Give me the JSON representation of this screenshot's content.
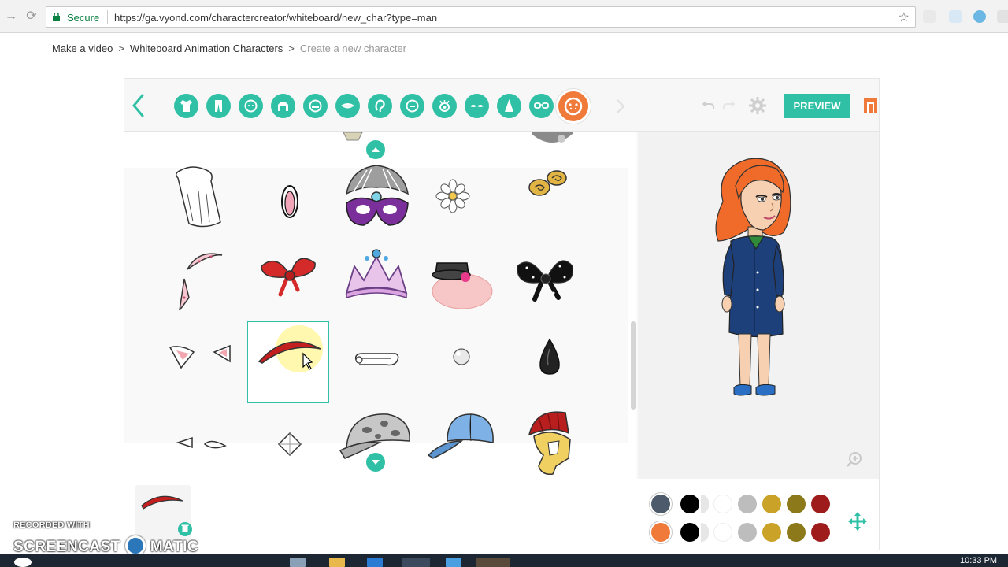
{
  "browser": {
    "secure_label": "Secure",
    "url": "https://ga.vyond.com/charactercreator/whiteboard/new_char?type=man",
    "icons": [
      "back-icon",
      "forward-icon",
      "reload-icon",
      "lock-icon",
      "star-icon"
    ]
  },
  "breadcrumb": {
    "items": [
      "Make a video",
      "Whiteboard Animation Characters",
      "Create a new character"
    ],
    "separator": ">"
  },
  "toolbar": {
    "categories": [
      "upper-body",
      "lower-body",
      "head",
      "hair",
      "face",
      "mouth",
      "ear",
      "nose",
      "eye",
      "eyebrow",
      "body-shape",
      "glasses",
      "accessories"
    ],
    "active_category": "accessories",
    "preview_label": "PREVIEW",
    "accent_color": "#2fc0a5",
    "active_color": "#f07a3a"
  },
  "items": {
    "rows": [
      [
        "chef-hat",
        "hair-clip",
        "feather-mask",
        "flower-pin",
        "gold-barrettes"
      ],
      [
        "cat-ear-band",
        "red-bow",
        "tiara",
        "mini-top-hat",
        "black-bow"
      ],
      [
        "cat-ears",
        "red-headband",
        "safety-pin",
        "pearl",
        "black-drop-clip"
      ],
      [
        "elf-ears",
        "diamond-pin",
        "camo-cap",
        "baseball-cap",
        "spartan-helmet"
      ]
    ],
    "selected": "red-headband"
  },
  "colors": {
    "row1": [
      "#4d5a6b",
      "#000000",
      "#ffffff",
      "#bdbdbd",
      "#c9a227",
      "#8c7a1a",
      "#9e1c1c"
    ],
    "row2": [
      "#f07a3a",
      "#000000",
      "#ffffff",
      "#bdbdbd",
      "#c9a227",
      "#8c7a1a",
      "#9e1c1c"
    ]
  },
  "watermark": {
    "recorded_with": "RECORDED WITH",
    "brand_left": "SCREENCAST",
    "brand_right": "MATIC"
  },
  "taskbar": {
    "time": "10:33 PM"
  }
}
